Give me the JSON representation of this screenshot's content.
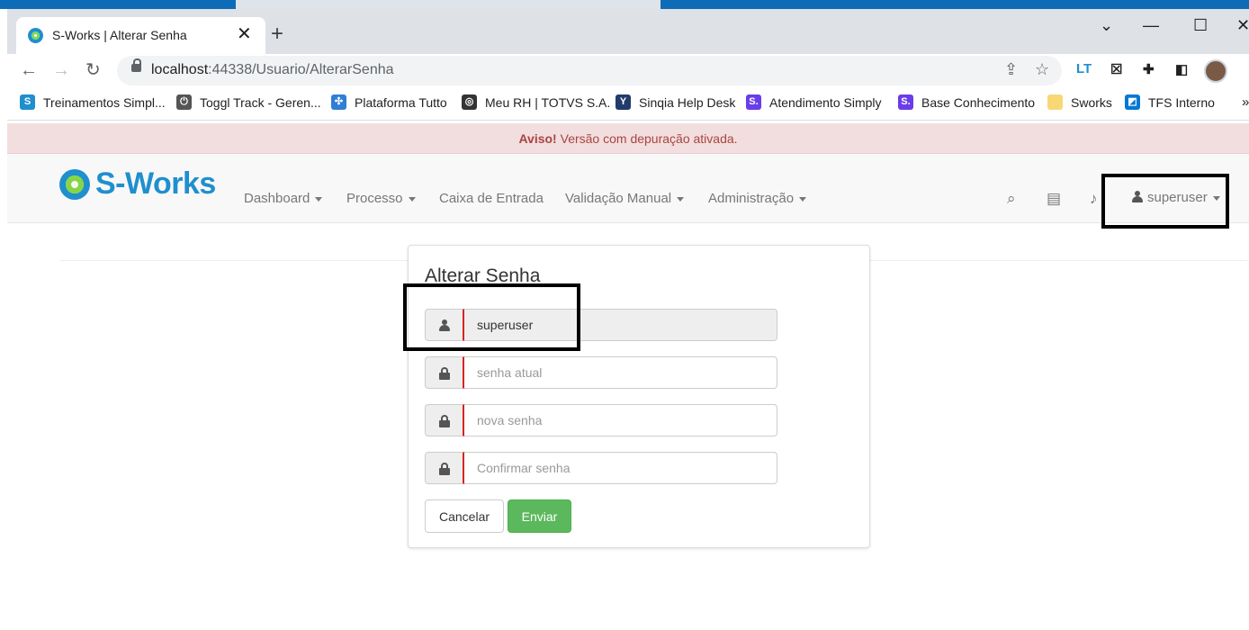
{
  "browser": {
    "tab_title": "S-Works | Alterar Senha",
    "tab_close": "✕",
    "new_tab": "+",
    "url_host": "localhost",
    "url_path": ":44338/Usuario/AlterarSenha",
    "bookmarks": [
      {
        "label": "Treinamentos Simpl...",
        "icon": "sworks-icon",
        "color": "#1f8fce"
      },
      {
        "label": "Toggl Track - Geren...",
        "icon": "power-icon",
        "color": "#555555"
      },
      {
        "label": "Plataforma Tutto",
        "icon": "tutto-icon",
        "color": "#2f7fd3"
      },
      {
        "label": "Meu RH | TOTVS S.A.",
        "icon": "totvs-icon",
        "color": "#333333"
      },
      {
        "label": "Sinqia Help Desk",
        "icon": "sinqia-icon",
        "color": "#223b6b"
      },
      {
        "label": "Atendimento Simply",
        "icon": "simply-icon",
        "color": "#6a3de8"
      },
      {
        "label": "Base Conhecimento",
        "icon": "simply-icon",
        "color": "#6a3de8"
      },
      {
        "label": "Sworks",
        "icon": "folder-icon",
        "color": "#f8d775"
      },
      {
        "label": "TFS Interno",
        "icon": "azure-devops-icon",
        "color": "#0078d4"
      }
    ],
    "bookmarks_more": "»"
  },
  "alert": {
    "strong": "Aviso!",
    "text": " Versão com depuração ativada."
  },
  "navbar": {
    "brand": "S-Works",
    "items": [
      "Dashboard",
      "Processo",
      "Caixa de Entrada",
      "Validação Manual",
      "Administração"
    ],
    "user": "superuser"
  },
  "form": {
    "title": "Alterar Senha",
    "username_value": "superuser",
    "current_password_placeholder": "senha atual",
    "new_password_placeholder": "nova senha",
    "confirm_password_placeholder": "Confirmar senha",
    "cancel_label": "Cancelar",
    "submit_label": "Enviar"
  },
  "colors": {
    "brand_blue": "#1f8fce",
    "success": "#5cb85c",
    "alert_bg": "#f2dede",
    "alert_text": "#a94442",
    "required_border": "#d9231f"
  }
}
